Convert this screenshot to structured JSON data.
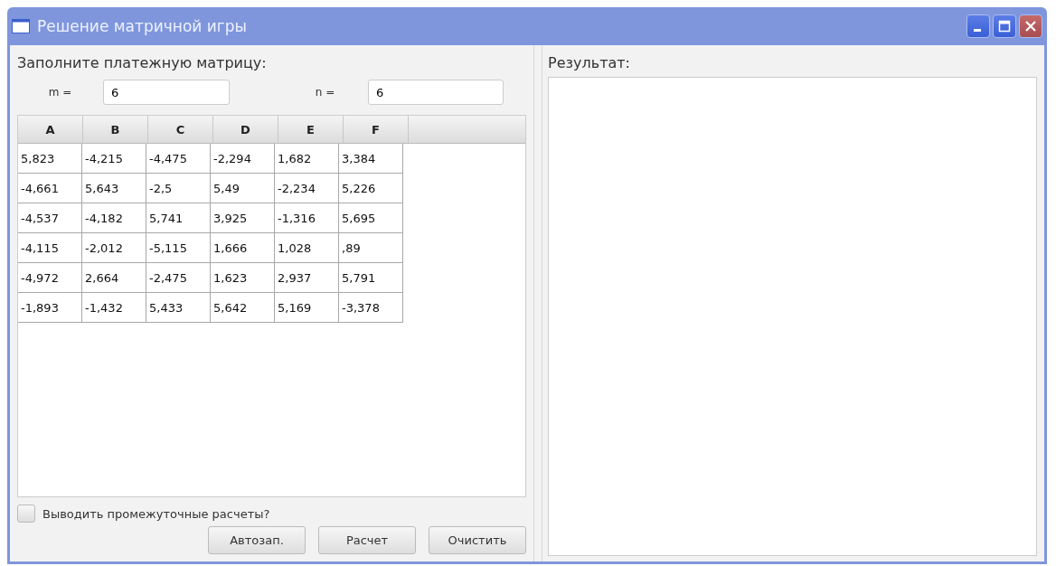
{
  "window": {
    "title": "Решение матричной игры"
  },
  "left": {
    "heading": "Заполните платежную матрицу:",
    "m": {
      "label": "m =",
      "value": "6"
    },
    "n": {
      "label": "n =",
      "value": "6"
    },
    "table": {
      "columns": [
        "A",
        "B",
        "C",
        "D",
        "E",
        "F"
      ],
      "rows": [
        [
          "5,823",
          "-4,215",
          "-4,475",
          "-2,294",
          "1,682",
          "3,384"
        ],
        [
          "-4,661",
          "5,643",
          "-2,5",
          "5,49",
          "-2,234",
          "5,226"
        ],
        [
          "-4,537",
          "-4,182",
          "5,741",
          "3,925",
          "-1,316",
          "5,695"
        ],
        [
          "-4,115",
          "-2,012",
          "-5,115",
          "1,666",
          "1,028",
          ",89"
        ],
        [
          "-4,972",
          "2,664",
          "-2,475",
          "1,623",
          "2,937",
          "5,791"
        ],
        [
          "-1,893",
          "-1,432",
          "5,433",
          "5,642",
          "5,169",
          "-3,378"
        ]
      ]
    },
    "show_steps": {
      "label": "Выводить промежуточные расчеты?",
      "checked": false
    },
    "buttons": [
      "Автозап.",
      "Расчет",
      "Очистить"
    ]
  },
  "right": {
    "heading": "Результат:"
  }
}
